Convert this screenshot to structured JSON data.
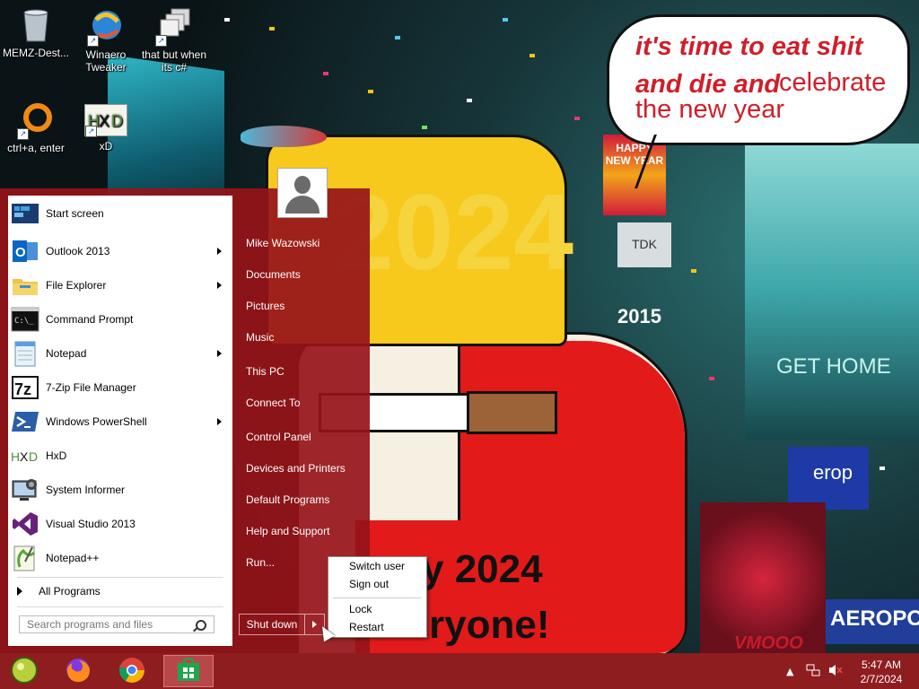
{
  "desktop": {
    "icons": [
      {
        "label": "MEMZ-Dest...",
        "icon": "recycle-bin-icon"
      },
      {
        "label": "Winaero Tweaker",
        "icon": "winaero-icon"
      },
      {
        "label": "that but when its c#",
        "icon": "stacked-windows-icon"
      },
      {
        "label": "ctrl+a, enter",
        "icon": "orange-ring-icon"
      },
      {
        "label": "xD",
        "icon": "hxd-icon"
      }
    ],
    "wallpaper": {
      "speech_line1": "it's time to eat shit",
      "speech_line2a": "and die and",
      "speech_line2b": "celebrate",
      "speech_line3": "the new year",
      "year_big": "2024",
      "bottom_line1": "y 2024",
      "bottom_line2": "ryone!",
      "sign_tdk": "TDK",
      "sign_happy": "HAPPY NEW YEAR",
      "sign_2015": "2015",
      "sign_gethome": "GET HOME",
      "sign_euro": "erop",
      "sign_aero": "AEROPOS",
      "sign_vm": "VMOOO"
    }
  },
  "start_menu": {
    "programs": [
      {
        "label": "Start screen",
        "icon": "start-screen-icon",
        "submenu": false
      },
      {
        "label": "Outlook 2013",
        "icon": "outlook-icon",
        "submenu": true
      },
      {
        "label": "File Explorer",
        "icon": "file-explorer-icon",
        "submenu": true
      },
      {
        "label": "Command Prompt",
        "icon": "command-prompt-icon",
        "submenu": false
      },
      {
        "label": "Notepad",
        "icon": "notepad-icon",
        "submenu": true
      },
      {
        "label": "7-Zip File Manager",
        "icon": "7zip-icon",
        "submenu": false
      },
      {
        "label": "Windows PowerShell",
        "icon": "powershell-icon",
        "submenu": true
      },
      {
        "label": "HxD",
        "icon": "hxd-icon",
        "submenu": false
      },
      {
        "label": "System Informer",
        "icon": "system-informer-icon",
        "submenu": false
      },
      {
        "label": "Visual Studio 2013",
        "icon": "visual-studio-icon",
        "submenu": false
      },
      {
        "label": "Notepad++",
        "icon": "notepadpp-icon",
        "submenu": false
      }
    ],
    "all_programs": "All Programs",
    "search_placeholder": "Search programs and files",
    "user_name": "Mike Wazowski",
    "right_items": [
      "Documents",
      "Pictures",
      "Music",
      "This PC",
      "Connect To",
      "Control Panel",
      "Devices and Printers",
      "Default Programs",
      "Help and Support",
      "Run..."
    ],
    "shutdown_label": "Shut down",
    "shutdown_menu": [
      "Switch user",
      "Sign out",
      "Lock",
      "Restart"
    ]
  },
  "taskbar": {
    "pinned": [
      "start-orb-icon",
      "firefox-icon",
      "chrome-icon",
      "store-icon"
    ],
    "clock_time": "5:47 AM",
    "clock_date": "2/7/2024",
    "colors": {
      "accent": "#8e1d20",
      "menu": "#96141a"
    }
  }
}
